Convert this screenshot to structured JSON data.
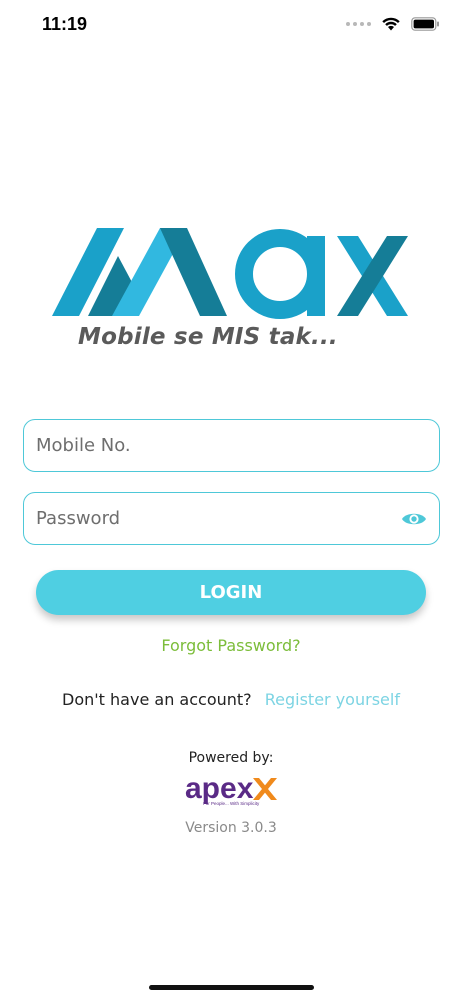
{
  "status_bar": {
    "time": "11:19",
    "icons": [
      "signal-dots-icon",
      "wifi-icon",
      "battery-icon"
    ]
  },
  "brand": {
    "logo_text": "Max",
    "tagline": "Mobile se MIS tak...",
    "colors": {
      "teal_dark": "#157d97",
      "teal": "#1aa1c9",
      "teal_light": "#31b8e0",
      "tagline": "#5a5a5a"
    }
  },
  "form": {
    "mobile": {
      "placeholder": "Mobile No.",
      "value": ""
    },
    "password": {
      "placeholder": "Password",
      "value": "",
      "toggle_icon": "eye-icon"
    },
    "login_label": "LOGIN",
    "forgot_label": "Forgot Password?",
    "register_prompt": "Don't have an account?",
    "register_label": "Register yourself"
  },
  "footer": {
    "powered_by": "Powered by:",
    "apex_logo_text": "apex",
    "apex_tagline": "For People... With Simplicity",
    "version": "Version 3.0.3"
  },
  "colors": {
    "accent": "#4fcfe2",
    "field_border": "#4ec8d8",
    "forgot": "#7cbd3a",
    "register_link": "#7dd4e3",
    "apex_purple": "#5a2a86",
    "apex_orange": "#f08a1c"
  }
}
